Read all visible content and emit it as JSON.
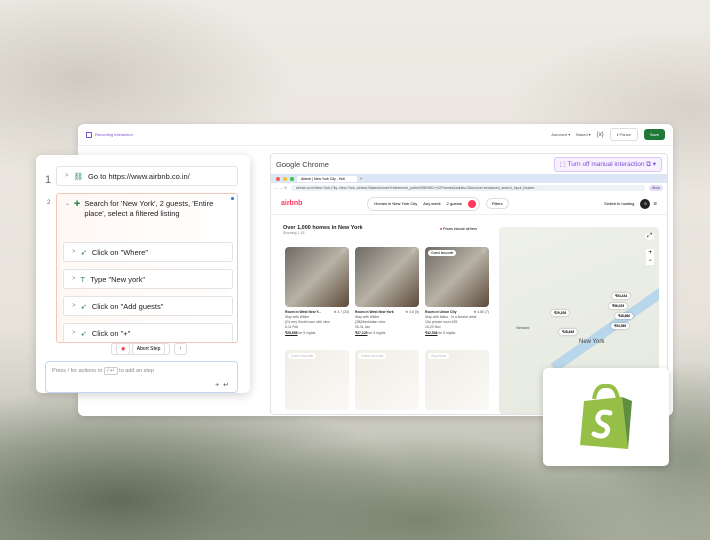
{
  "header": {
    "recording": "Recording interaction",
    "autonext": "Autonext ▾",
    "based": "Based ▾",
    "vars": "{x}",
    "pause": "Pause",
    "save": "Save"
  },
  "steps": {
    "n1": "1",
    "step1": "Go to https://www.airbnb.co.in/",
    "n2": "2",
    "step2": "Search for 'New York', 2 guests, 'Entire place', select a filtered listing",
    "substeps": [
      "Click on \"Where\"",
      "Type \"New york\"",
      "Click on \"Add guests\"",
      "Click on \"+\""
    ],
    "abort": "Abort Step",
    "up": "↑",
    "prompt_a": "Press / for actions or",
    "prompt_key": "/ ↵",
    "prompt_b": "to add an step",
    "plus": "+",
    "enter": "↵"
  },
  "browser": {
    "title": "Google Chrome",
    "turnoff": "Turn off manual interaction",
    "tab": "Airbnb | New York City - Holi",
    "url": "airbnb.co.in/New-York-City--New-York--United-States/homes?refinement_paths%5B%5D=%2Fhomes&adults=2&source=structured_search_input_header...",
    "work": "Work"
  },
  "airbnb": {
    "logo": "airbnb",
    "where": "Homes in New York City",
    "when": "Any week",
    "guests": "2 guests",
    "filters": "Filters",
    "host": "Switch to hosting",
    "avatar": "S",
    "heading": "Over 1,000 homes in New York",
    "showing": "Showing 1-18",
    "fees": "Prices include all fees",
    "listings": [
      {
        "title": "Room in West New Y...",
        "rating": "★ 4.7 (33)",
        "l1": "Stay with Wilder",
        "l2": "(D) very Small room with view",
        "dates": "6-11 Feb",
        "price": "₹28,658",
        "per": "for 5 nights"
      },
      {
        "title": "Room in West New York",
        "rating": "★ 4.6 (5)",
        "l1": "Stay with Wilder",
        "l2": "(2B)Manhattan view",
        "dates": "26-31 Jan",
        "price": "₹27,125",
        "per": "for 5 nights"
      },
      {
        "title": "Room in Union City",
        "rating": "★ 4.86 (7)",
        "l1": "Stay with Mario · In a bizarre artist",
        "l2": "City private room #25",
        "dates": "15-20 Nov",
        "price": "₹42,536",
        "per": "for 5 nights",
        "badge": "Guest favourite"
      }
    ],
    "row2": [
      "Guest favourite",
      "Guest favourite",
      "Superhost"
    ],
    "map": {
      "pins": [
        "₹54,434",
        "₹56,029",
        "₹29,208",
        "₹48,860",
        "₹54,589",
        "₹28,845"
      ],
      "city": "New York",
      "newark": "Newark"
    }
  }
}
